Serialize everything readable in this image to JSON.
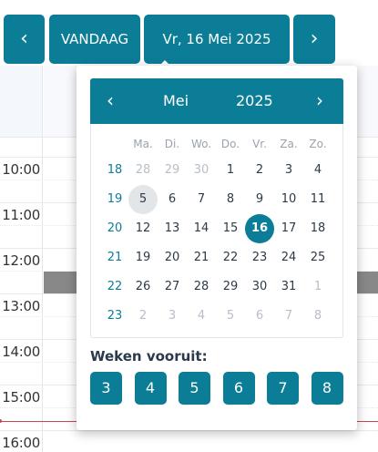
{
  "toolbar": {
    "prev_label": "‹",
    "today_label": "VANDAAG",
    "date_label": "Vr, 16 Mei 2025",
    "next_label": "›"
  },
  "time_labels": [
    "10:00",
    "11:00",
    "12:00",
    "13:00",
    "14:00",
    "15:00",
    "16:00"
  ],
  "datepicker": {
    "month": "Mei",
    "year": "2025",
    "prev_label": "‹",
    "next_label": "›",
    "weekdays": [
      "Ma.",
      "Di.",
      "Wo.",
      "Do.",
      "Vr.",
      "Za.",
      "Zo."
    ],
    "weeks": [
      {
        "week": "18",
        "days": [
          "28",
          "29",
          "30",
          "1",
          "2",
          "3",
          "4"
        ]
      },
      {
        "week": "19",
        "days": [
          "5",
          "6",
          "7",
          "8",
          "9",
          "10",
          "11"
        ]
      },
      {
        "week": "20",
        "days": [
          "12",
          "13",
          "14",
          "15",
          "16",
          "17",
          "18"
        ]
      },
      {
        "week": "21",
        "days": [
          "19",
          "20",
          "21",
          "22",
          "23",
          "24",
          "25"
        ]
      },
      {
        "week": "22",
        "days": [
          "26",
          "27",
          "28",
          "29",
          "30",
          "31",
          "1"
        ]
      },
      {
        "week": "23",
        "days": [
          "2",
          "3",
          "4",
          "5",
          "6",
          "7",
          "8"
        ]
      }
    ],
    "today": "5",
    "selected": "16",
    "weeks_ahead_label": "Weken vooruit:",
    "weeks_ahead_options": [
      "3",
      "4",
      "5",
      "6",
      "7",
      "8"
    ]
  },
  "colors": {
    "accent": "#0b7d97",
    "event": "#888888",
    "now_line": "#c9474e"
  }
}
